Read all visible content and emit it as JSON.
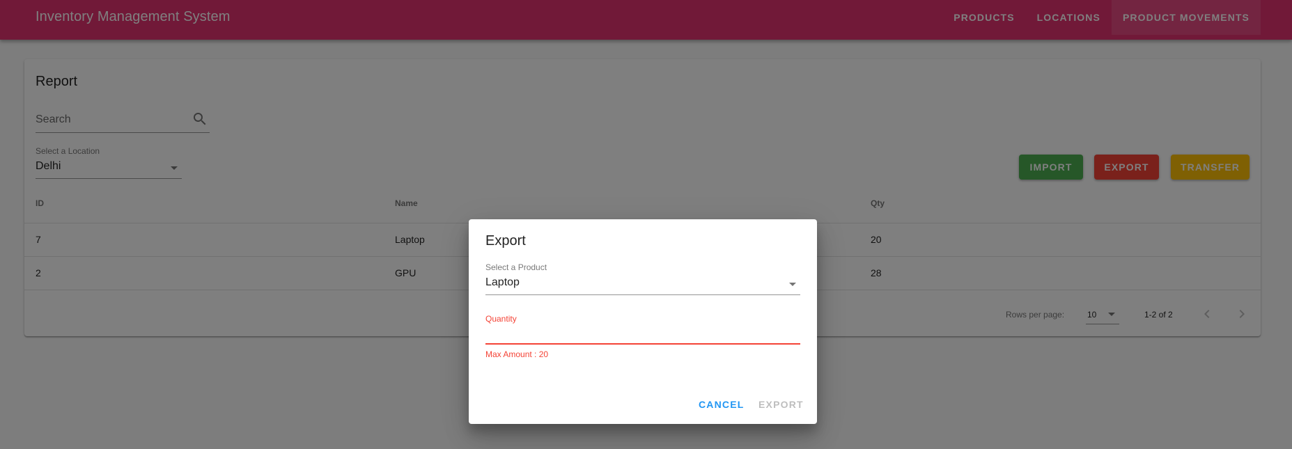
{
  "app": {
    "title": "Inventory Management System",
    "accent": "#e33371"
  },
  "nav": {
    "items": [
      {
        "label": "PRODUCTS"
      },
      {
        "label": "LOCATIONS"
      },
      {
        "label": "PRODUCT MOVEMENTS",
        "active": true
      }
    ]
  },
  "report": {
    "title": "Report",
    "search_placeholder": "Search",
    "location_label": "Select a Location",
    "location_value": "Delhi",
    "buttons": {
      "import": "IMPORT",
      "export": "EXPORT",
      "transfer": "TRANSFER"
    },
    "table": {
      "headers": [
        "ID",
        "Name",
        "Qty"
      ],
      "rows": [
        [
          "7",
          "Laptop",
          "20"
        ],
        [
          "2",
          "GPU",
          "28"
        ]
      ]
    },
    "pagination": {
      "rows_per_page_label": "Rows per page:",
      "rows_per_page": "10",
      "range": "1-2 of 2"
    }
  },
  "dialog": {
    "title": "Export",
    "product_label": "Select a Product",
    "product_value": "Laptop",
    "quantity_label": "Quantity",
    "quantity_value": "",
    "helper": "Max Amount : 20",
    "cancel": "CANCEL",
    "confirm": "EXPORT"
  }
}
